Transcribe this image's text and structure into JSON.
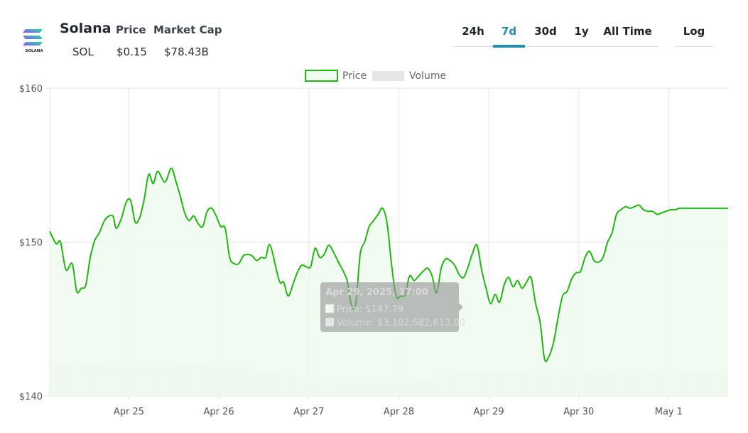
{
  "coin": {
    "name": "Solana",
    "symbol": "SOL",
    "logo_text": "SOLANA",
    "price_heading": "Price",
    "price_value": "$0.15",
    "marketcap_heading": "Market Cap",
    "marketcap_value": "$78.43B"
  },
  "tabs": [
    {
      "label": "24h",
      "active": false
    },
    {
      "label": "7d",
      "active": true
    },
    {
      "label": "30d",
      "active": false
    },
    {
      "label": "1y",
      "active": false
    },
    {
      "label": "All Time",
      "active": false
    }
  ],
  "log_label": "Log",
  "colors": {
    "price_line": "#1fb80f",
    "price_fill": "#eefaee",
    "volume": "#e6e6e6",
    "accent": "#1e8fb0",
    "grid": "#e4e4e4"
  },
  "tooltip": {
    "title": "Apr 29, 2025, 17:00",
    "price": "Price: $147.79",
    "volume": "Volume: $3,102,582,613.00"
  },
  "chart_data": {
    "type": "line",
    "legend": [
      "Price",
      "Volume"
    ],
    "legend_position": "top-center",
    "grid": true,
    "y_ticks": [
      "$160",
      "$150",
      "$140"
    ],
    "ylim": [
      140,
      160
    ],
    "x_ticks": [
      "Apr 25",
      "Apr 26",
      "Apr 27",
      "Apr 28",
      "Apr 29",
      "Apr 30",
      "May 1"
    ],
    "x_tick_pos": [
      0.88,
      1.88,
      2.88,
      3.88,
      4.88,
      5.88,
      6.88
    ],
    "xlim": [
      0,
      7.54
    ],
    "series": [
      {
        "name": "Price",
        "x": [
          0.0,
          0.07,
          0.12,
          0.18,
          0.25,
          0.3,
          0.35,
          0.4,
          0.45,
          0.5,
          0.55,
          0.62,
          0.7,
          0.74,
          0.8,
          0.85,
          0.9,
          0.95,
          1.0,
          1.05,
          1.1,
          1.15,
          1.2,
          1.28,
          1.35,
          1.4,
          1.45,
          1.5,
          1.55,
          1.6,
          1.65,
          1.7,
          1.75,
          1.8,
          1.85,
          1.9,
          1.95,
          2.0,
          2.05,
          2.1,
          2.15,
          2.2,
          2.25,
          2.3,
          2.35,
          2.4,
          2.45,
          2.55,
          2.6,
          2.65,
          2.7,
          2.75,
          2.8,
          2.85,
          2.9,
          2.95,
          3.0,
          3.05,
          3.1,
          3.15,
          3.2,
          3.3,
          3.35,
          3.4,
          3.45,
          3.5,
          3.55,
          3.6,
          3.65,
          3.7,
          3.75,
          3.8,
          3.85,
          3.9,
          3.95,
          4.0,
          4.05,
          4.1,
          4.15,
          4.2,
          4.25,
          4.3,
          4.35,
          4.4,
          4.45,
          4.5,
          4.55,
          4.6,
          4.65,
          4.7,
          4.75,
          4.8,
          4.85,
          4.9,
          4.95,
          5.0,
          5.05,
          5.1,
          5.15,
          5.2,
          5.25,
          5.3,
          5.35,
          5.4,
          5.45,
          5.5,
          5.55,
          5.6,
          5.65,
          5.7,
          5.75,
          5.8,
          5.85,
          5.9,
          5.95,
          6.0,
          6.05,
          6.1,
          6.15,
          6.2,
          6.25,
          6.3,
          6.35,
          6.4,
          6.45,
          6.5,
          6.55,
          6.6,
          6.65,
          6.7,
          6.75,
          6.8,
          6.85,
          6.9,
          6.95,
          7.0,
          7.05,
          7.1,
          7.15,
          7.2,
          7.25,
          7.3,
          7.35,
          7.4,
          7.45,
          7.5,
          7.54
        ],
        "y": [
          150.7,
          149.9,
          150.0,
          148.2,
          148.6,
          146.8,
          147.0,
          147.2,
          149.0,
          150.1,
          150.6,
          151.5,
          151.7,
          150.9,
          151.6,
          152.6,
          152.7,
          151.3,
          151.6,
          152.8,
          154.4,
          153.8,
          154.6,
          153.9,
          154.8,
          154.0,
          153.0,
          151.9,
          151.4,
          151.7,
          151.2,
          151.0,
          152.0,
          152.2,
          151.7,
          151.0,
          150.9,
          149.0,
          148.6,
          148.6,
          149.1,
          149.2,
          149.1,
          148.8,
          149.0,
          149.0,
          149.8,
          147.5,
          147.4,
          146.5,
          147.2,
          148.0,
          148.5,
          148.4,
          148.4,
          149.6,
          149.0,
          149.2,
          149.8,
          149.4,
          148.8,
          147.6,
          146.0,
          145.9,
          149.2,
          150.0,
          151.0,
          151.4,
          151.8,
          152.2,
          151.2,
          148.5,
          146.5,
          146.5,
          146.6,
          147.8,
          147.5,
          147.8,
          148.1,
          148.3,
          147.8,
          146.7,
          148.3,
          148.9,
          148.8,
          148.5,
          147.9,
          147.7,
          148.4,
          149.3,
          149.8,
          148.2,
          147.0,
          146.0,
          146.6,
          146.1,
          147.2,
          147.7,
          147.1,
          147.5,
          147.0,
          147.4,
          147.7,
          146.0,
          144.8,
          142.4,
          142.6,
          143.5,
          145.1,
          146.5,
          146.8,
          147.6,
          148.0,
          148.1,
          149.0,
          149.4,
          148.8,
          148.7,
          149.0,
          150.0,
          150.6,
          151.8,
          152.1,
          152.3,
          152.2,
          152.3,
          152.4,
          152.1,
          152.0,
          152.0,
          151.8,
          151.9,
          152.0,
          152.1,
          152.1,
          152.2,
          152.2,
          152.2,
          152.2,
          152.2,
          152.2,
          152.2,
          152.2,
          152.2,
          152.2,
          152.2,
          152.2
        ]
      },
      {
        "name": "Volume",
        "x": [
          0.0,
          0.5,
          1.0,
          1.5,
          2.0,
          2.5,
          3.0,
          3.5,
          4.0,
          4.5,
          5.0,
          5.5,
          6.0,
          6.5,
          7.0,
          7.54
        ],
        "y": [
          140.0,
          140.0,
          140.0,
          140.0,
          140.0,
          140.0,
          140.0,
          140.0,
          140.0,
          140.0,
          140.0,
          140.0,
          140.0,
          140.0,
          140.0,
          140.0
        ]
      }
    ]
  }
}
